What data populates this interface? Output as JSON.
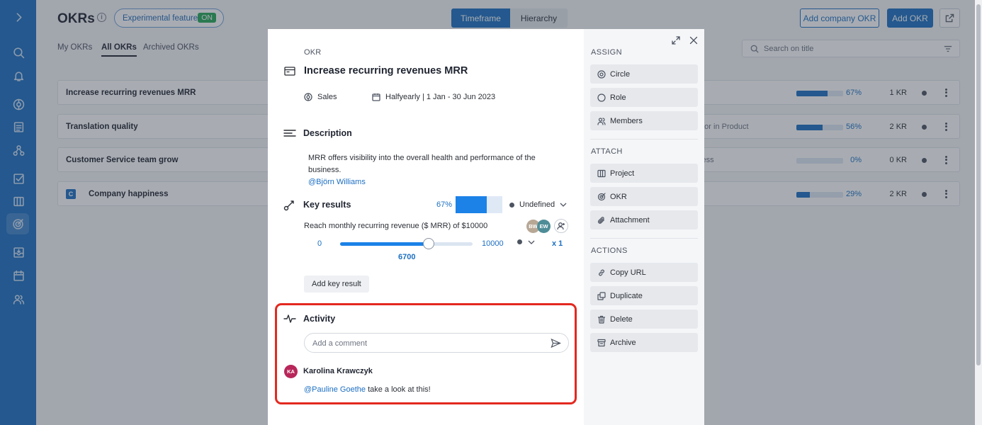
{
  "page": {
    "title": "OKRs",
    "experimental_label": "Experimental feature",
    "experimental_state": "ON",
    "view_toggle": [
      "Timeframe",
      "Hierarchy"
    ],
    "add_company_okr": "Add company OKR",
    "add_okr": "Add OKR",
    "tabs": [
      "My OKRs",
      "All OKRs",
      "Archived OKRs"
    ],
    "search_placeholder": "Search on title",
    "rows": [
      {
        "name": "Increase recurring revenues MRR",
        "meta": "",
        "progress": 67,
        "pct": "67%",
        "kr": "1 KR"
      },
      {
        "name": "Translation quality",
        "meta": "ator in Product",
        "progress": 56,
        "pct": "56%",
        "kr": "2 KR"
      },
      {
        "name": "Customer Service team grow",
        "meta": "cess",
        "progress": 0,
        "pct": "0%",
        "kr": "0 KR"
      },
      {
        "name": "Company happiness",
        "badge": "C",
        "meta": "",
        "progress": 29,
        "pct": "29%",
        "kr": "2 KR"
      }
    ]
  },
  "modal": {
    "label": "OKR",
    "title": "Increase recurring revenues MRR",
    "circle": "Sales",
    "timeframe": "Halfyearly | 1 Jan - 30 Jun 2023",
    "description": {
      "heading": "Description",
      "text": "MRR offers visibility into the overall health and performance of the business.",
      "mention": "@Björn Williams"
    },
    "key_results": {
      "heading": "Key results",
      "pct": "67%",
      "progress": 67,
      "status": "Undefined",
      "item": "Reach monthly recurring revenue ($ MRR) of $10000",
      "avatars": [
        {
          "initials": "BW",
          "color": "#b7a795"
        },
        {
          "initials": "EW",
          "color": "#4e8d97"
        }
      ],
      "min": "0",
      "max": "10000",
      "current": "6700",
      "slider_fraction": 0.67,
      "weight": "x 1",
      "add_button": "Add key result"
    },
    "activity": {
      "heading": "Activity",
      "comment_placeholder": "Add a comment",
      "comments": [
        {
          "initials": "KA",
          "author": "Karolina Krawczyk",
          "mention": "@Pauline Goethe",
          "text": " take a look at this!"
        }
      ]
    },
    "sidebar": {
      "assign_heading": "ASSIGN",
      "assign": [
        "Circle",
        "Role",
        "Members"
      ],
      "attach_heading": "ATTACH",
      "attach": [
        "Project",
        "OKR",
        "Attachment"
      ],
      "actions_heading": "ACTIONS",
      "actions": [
        "Copy URL",
        "Duplicate",
        "Delete",
        "Archive"
      ]
    }
  },
  "colors": {
    "primary": "#1c6fc2",
    "highlight": "#e4281f",
    "nav": "#1c6fc2",
    "avatar_ka": "#b8265a"
  }
}
